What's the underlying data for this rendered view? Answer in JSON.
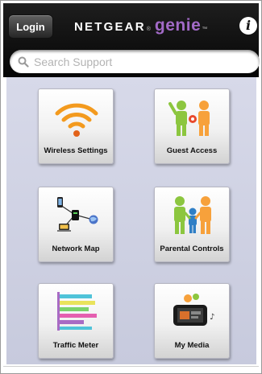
{
  "header": {
    "login_label": "Login",
    "brand_netgear": "NETGEAR",
    "brand_registered": "®",
    "brand_genie": "genie",
    "brand_tm": "™",
    "info_icon": "info-icon"
  },
  "search": {
    "placeholder": "Search Support",
    "value": ""
  },
  "tiles": [
    {
      "label": "Wireless Settings",
      "icon": "wifi-icon"
    },
    {
      "label": "Guest Access",
      "icon": "guest-access-icon"
    },
    {
      "label": "Network Map",
      "icon": "network-map-icon"
    },
    {
      "label": "Parental Controls",
      "icon": "family-icon"
    },
    {
      "label": "Traffic Meter",
      "icon": "bar-graph-icon"
    },
    {
      "label": "My Media",
      "icon": "media-player-icon"
    }
  ],
  "colors": {
    "header_bg": "#0a0a0a",
    "genie_purple": "#a26ac7",
    "content_bg": "#d0d2e4",
    "wifi_orange": "#f39a1e",
    "people_green": "#8cc63f",
    "people_orange": "#f7a13b",
    "people_blue": "#2f7fc6"
  }
}
